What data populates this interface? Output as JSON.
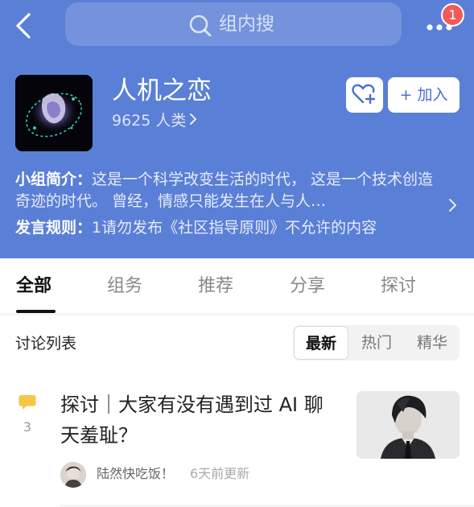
{
  "colors": {
    "header_bg": "#5a7fd6",
    "accent": "#4a6fcf",
    "badge": "#f25a5a",
    "comment_icon": "#f5c64a"
  },
  "nav": {
    "back_icon": "chevron-left-icon",
    "search_placeholder": "组内搜",
    "search_icon": "search-icon",
    "more_icon": "more-horizontal-icon",
    "notification_count": "1"
  },
  "group": {
    "title": "人机之恋",
    "members": "9625 人类",
    "favorite_icon": "heart-plus-icon",
    "join_label": "+ 加入",
    "intro_label": "小组简介：",
    "intro_text": "这是一个科学改变生活的时代， 这是一个技术创造奇迹的时代。 曾经，情感只能发生在人与人…",
    "rules_label": "发言规则：",
    "rules_text": "1请勿发布《社区指导原则》不允许的内容"
  },
  "tabs": [
    {
      "label": "全部",
      "active": true
    },
    {
      "label": "组务",
      "active": false
    },
    {
      "label": "推荐",
      "active": false
    },
    {
      "label": "分享",
      "active": false
    },
    {
      "label": "探讨",
      "active": false
    }
  ],
  "discussion": {
    "title": "讨论列表",
    "sort_options": [
      "最新",
      "热门",
      "精华"
    ],
    "sort_selected": "最新"
  },
  "posts": [
    {
      "title": "探讨｜大家有没有遇到过 AI 聊天羞耻？",
      "comment_count": "3",
      "author": "陆然快吃饭！",
      "time": "6天前更新"
    }
  ]
}
